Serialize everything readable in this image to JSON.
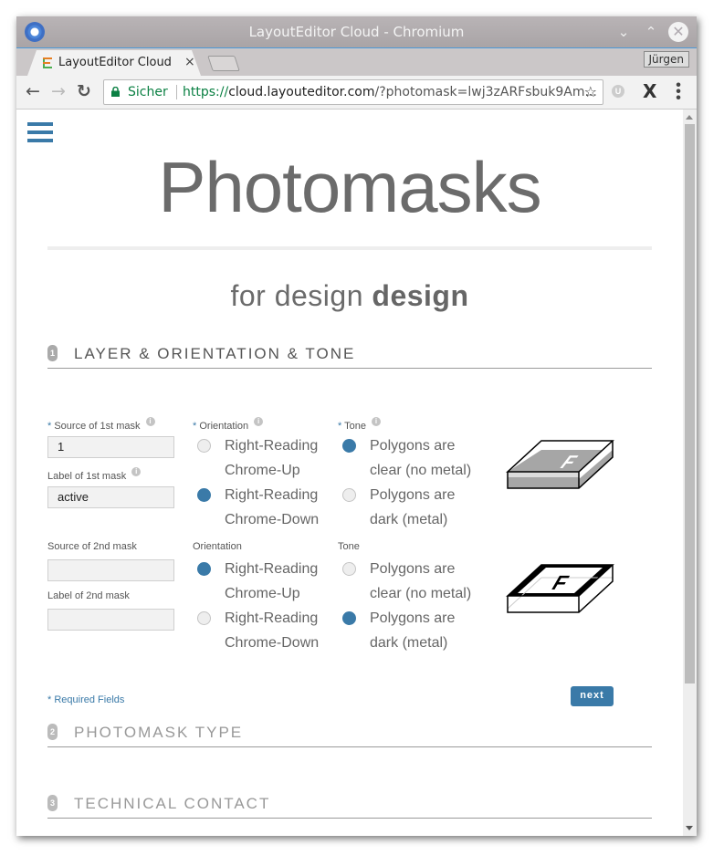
{
  "window": {
    "title": "LayoutEditor Cloud - Chromium",
    "minimize_glyph": "⌄",
    "maximize_glyph": "⌃",
    "close_glyph": "✕"
  },
  "tabs": [
    {
      "label": "LayoutEditor Cloud",
      "close_glyph": "×",
      "active": true
    }
  ],
  "profile_label": "Jürgen",
  "toolbar": {
    "back_glyph": "←",
    "forward_glyph": "→",
    "reload_glyph": "↻",
    "secure_label": "Sicher",
    "url_scheme": "https://",
    "url_host": "cloud.layouteditor.com",
    "url_rest": "/?photomask=lwj3zARFsbuk9Am...",
    "star_glyph": "☆",
    "ext1_glyph": "U",
    "ext2_glyph": "X",
    "menu_glyph": "⋮"
  },
  "page": {
    "title": "Photomasks",
    "subtitle_prefix": "for design ",
    "subtitle_bold": "design",
    "sections": [
      {
        "number": "1",
        "title": "LAYER & ORIENTATION & TONE"
      },
      {
        "number": "2",
        "title": "PHOTOMASK TYPE"
      },
      {
        "number": "3",
        "title": "TECHNICAL CONTACT"
      }
    ],
    "mask1": {
      "source_label": "Source of 1st mask",
      "source_value": "1",
      "label_label": "Label of 1st mask",
      "label_value": "active",
      "orientation_label": "Orientation",
      "orientation_options": [
        {
          "line1": "Right-Reading",
          "line2": "Chrome-Up",
          "selected": false
        },
        {
          "line1": "Right-Reading",
          "line2": "Chrome-Down",
          "selected": true
        }
      ],
      "tone_label": "Tone",
      "tone_options": [
        {
          "line1": "Polygons are",
          "line2": "clear (no metal)",
          "selected": true
        },
        {
          "line1": "Polygons are",
          "line2": "dark (metal)",
          "selected": false
        }
      ],
      "illustration": "mask-clear-polygons-icon"
    },
    "mask2": {
      "source_label": "Source of 2nd mask",
      "source_value": "",
      "label_label": "Label of 2nd mask",
      "label_value": "",
      "orientation_label": "Orientation",
      "orientation_options": [
        {
          "line1": "Right-Reading",
          "line2": "Chrome-Up",
          "selected": true
        },
        {
          "line1": "Right-Reading",
          "line2": "Chrome-Down",
          "selected": false
        }
      ],
      "tone_label": "Tone",
      "tone_options": [
        {
          "line1": "Polygons are",
          "line2": "clear (no metal)",
          "selected": false
        },
        {
          "line1": "Polygons are",
          "line2": "dark (metal)",
          "selected": true
        }
      ],
      "illustration": "mask-dark-polygons-icon"
    },
    "required_marker": "*",
    "info_glyph": "i",
    "required_note": "* Required Fields",
    "next_label": "next"
  },
  "colors": {
    "accent": "#3a7aa8",
    "text": "#666666",
    "secure": "#0b8043"
  }
}
